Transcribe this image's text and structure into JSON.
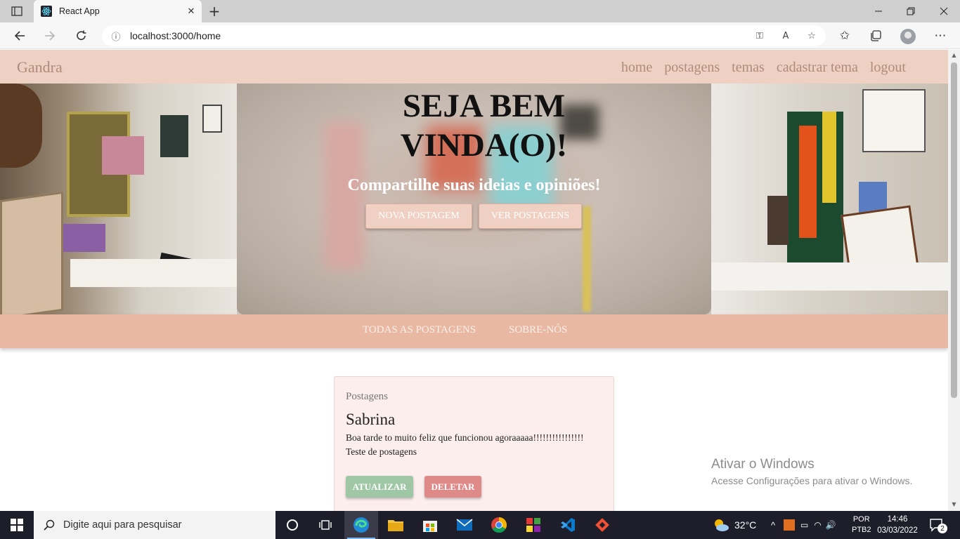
{
  "browser": {
    "tab_title": "React App",
    "new_tab": "+",
    "address": "localhost:3000/home"
  },
  "navbar": {
    "brand": "Gandra",
    "links": [
      "home",
      "postagens",
      "temas",
      "cadastrar tema",
      "logout"
    ]
  },
  "hero": {
    "title_line1": "SEJA BEM",
    "title_line2": "VINDA(O)!",
    "subtitle": "Compartilhe suas ideias e opiniões!",
    "btn_new_post": "NOVA POSTAGEM",
    "btn_view_posts": "VER POSTAGENS"
  },
  "subnav": {
    "all_posts": "TODAS AS POSTAGENS",
    "about": "SOBRE-NÓS"
  },
  "post": {
    "section_label": "Postagens",
    "author": "Sabrina",
    "text": "Boa tarde to muito feliz que funcionou agoraaaaa!!!!!!!!!!!!!!!!",
    "theme": "Teste de postagens",
    "update_label": "ATUALIZAR",
    "delete_label": "DELETAR"
  },
  "watermark": {
    "line1": "Ativar o Windows",
    "line2": "Acesse Configurações para ativar o Windows."
  },
  "taskbar": {
    "search_placeholder": "Digite aqui para pesquisar",
    "weather": "32°C",
    "lang1": "POR",
    "lang2": "PTB2",
    "time": "14:46",
    "date": "03/03/2022",
    "notifications": "2"
  },
  "colors": {
    "navbar": "#efd1c4",
    "subnav": "#e8b8a2",
    "update_btn": "#9fc7a5",
    "delete_btn": "#dd8a89",
    "card_bg": "#fbeeed"
  }
}
